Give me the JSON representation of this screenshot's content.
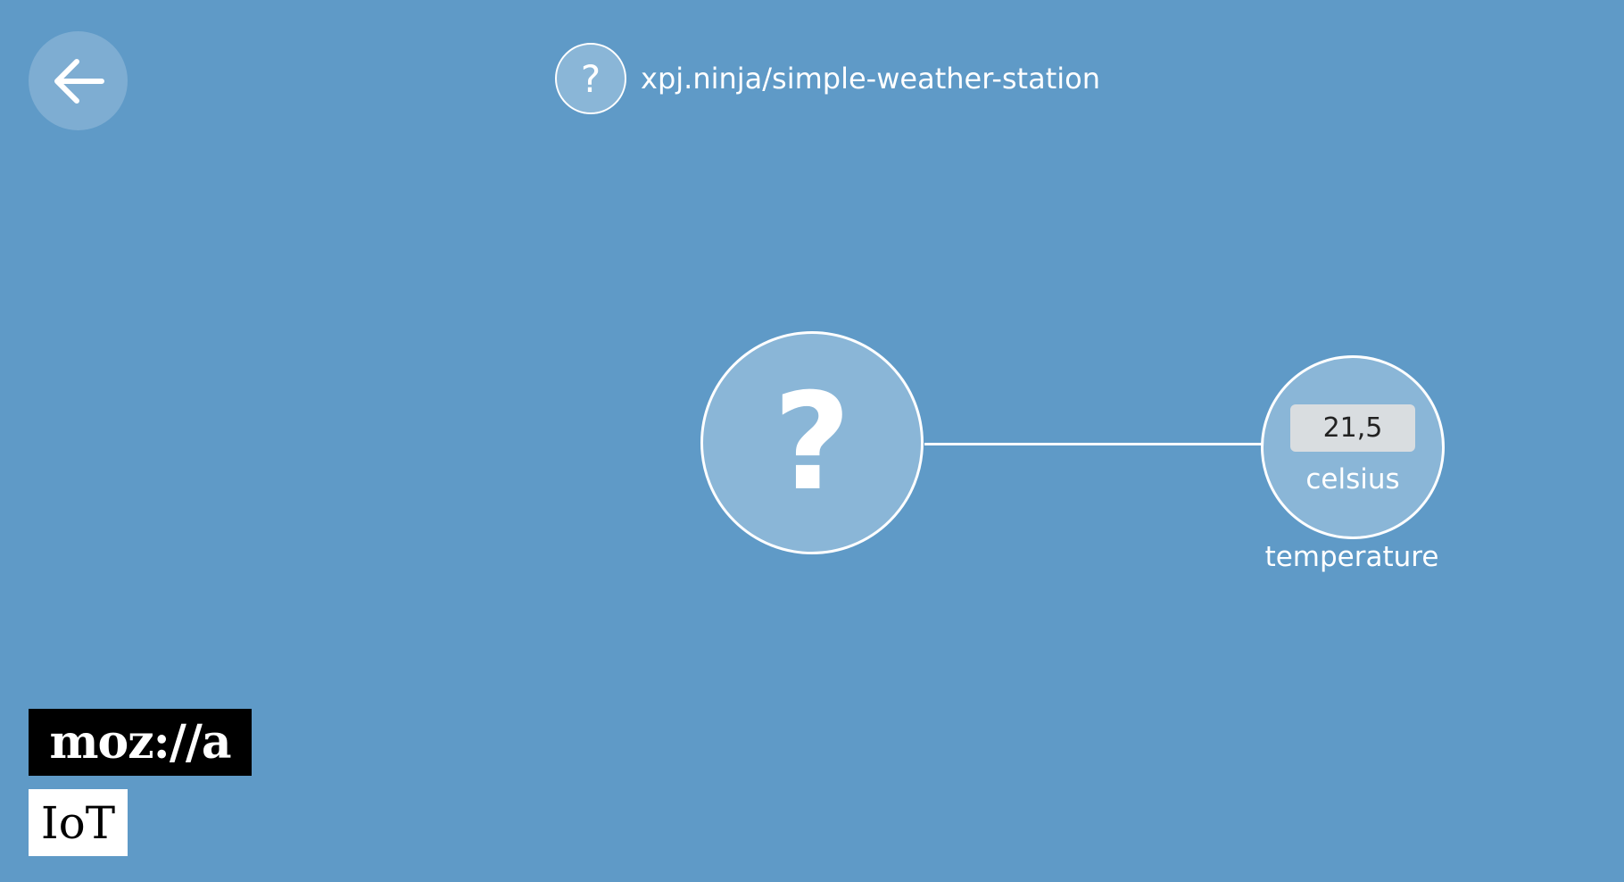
{
  "header": {
    "icon_glyph": "?",
    "title": "xpj.ninja/simple-weather-station"
  },
  "back_button": {
    "icon": "arrow-left-icon"
  },
  "device": {
    "icon_glyph": "?"
  },
  "property": {
    "value": "21,5",
    "unit": "celsius",
    "label": "temperature"
  },
  "branding": {
    "mozilla": "moz://a",
    "iot": "IoT"
  },
  "colors": {
    "background": "#5f9ac7",
    "node_fill": "#8ab6d7",
    "back_button_fill": "#7eadd2",
    "value_box": "#d9dde0"
  }
}
